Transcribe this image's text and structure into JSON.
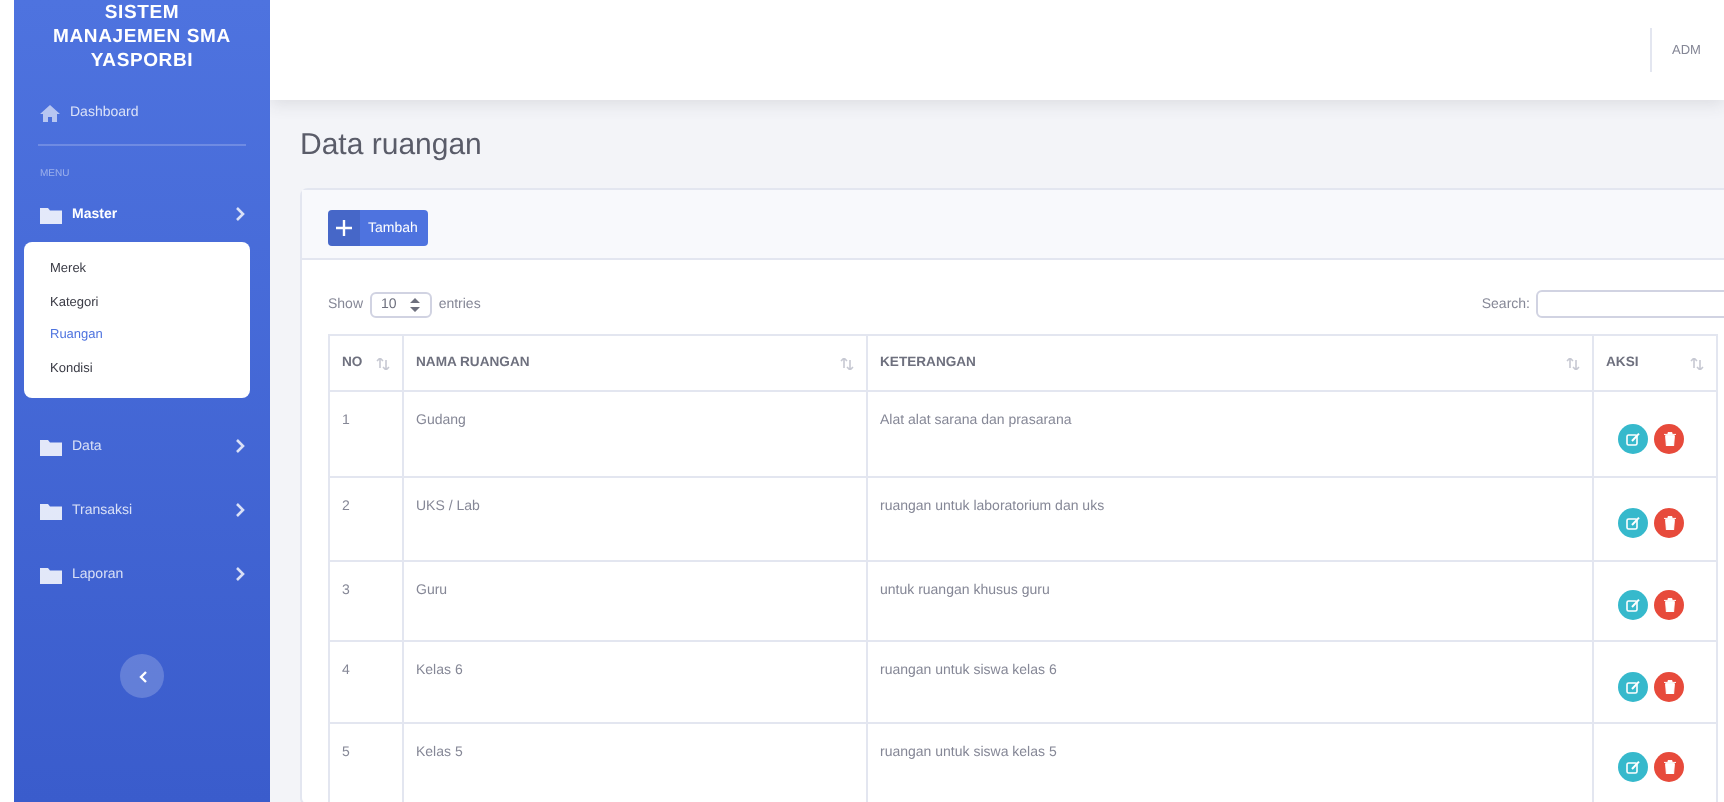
{
  "sidebar": {
    "brand": "SISTEM MANAJEMEN SMA YASPORBI",
    "items": [
      {
        "kind": "link",
        "label": "Dashboard"
      },
      {
        "kind": "heading",
        "label": "MENU"
      },
      {
        "kind": "group",
        "label": "Master",
        "expanded": true,
        "children": [
          {
            "label": "Merek",
            "selected": false
          },
          {
            "label": "Kategori",
            "selected": false
          },
          {
            "label": "Ruangan",
            "selected": true
          },
          {
            "label": "Kondisi",
            "selected": false
          }
        ]
      },
      {
        "kind": "group",
        "label": "Data",
        "expanded": false
      },
      {
        "kind": "group",
        "label": "Transaksi",
        "expanded": false
      },
      {
        "kind": "group",
        "label": "Laporan",
        "expanded": false
      }
    ]
  },
  "topbar": {
    "user": "ADM"
  },
  "page_title": "Data ruangan",
  "add_button": "Tambah",
  "length": {
    "show": "Show",
    "value": "10",
    "entries": "entries"
  },
  "search": {
    "label": "Search:"
  },
  "table": {
    "columns": [
      "NO",
      "NAMA RUANGAN",
      "KETERANGAN",
      "AKSI"
    ],
    "rows": [
      {
        "no": "1",
        "nama": "Gudang",
        "keterangan": "Alat alat sarana dan prasarana"
      },
      {
        "no": "2",
        "nama": "UKS / Lab",
        "keterangan": "ruangan untuk laboratorium dan uks"
      },
      {
        "no": "3",
        "nama": "Guru",
        "keterangan": "untuk ruangan khusus guru"
      },
      {
        "no": "4",
        "nama": "Kelas 6",
        "keterangan": "ruangan untuk siswa kelas 6"
      },
      {
        "no": "5",
        "nama": "Kelas 5",
        "keterangan": "ruangan untuk siswa kelas 5"
      }
    ]
  }
}
